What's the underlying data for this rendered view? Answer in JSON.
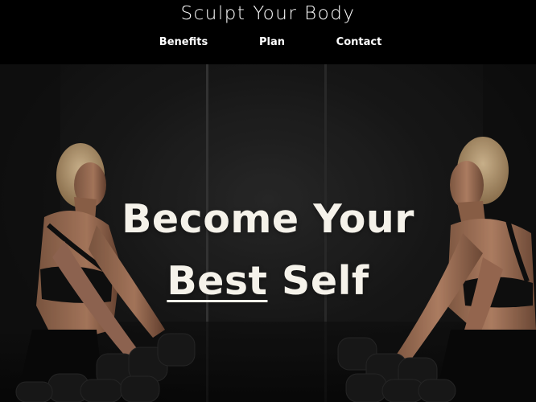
{
  "header": {
    "brand": "Sculpt Your Body",
    "nav": [
      {
        "label": "Benefits"
      },
      {
        "label": "Plan"
      },
      {
        "label": "Contact"
      }
    ]
  },
  "hero": {
    "line1": "Become Your",
    "line2_underlined": "Best",
    "line2_rest": " Self"
  }
}
